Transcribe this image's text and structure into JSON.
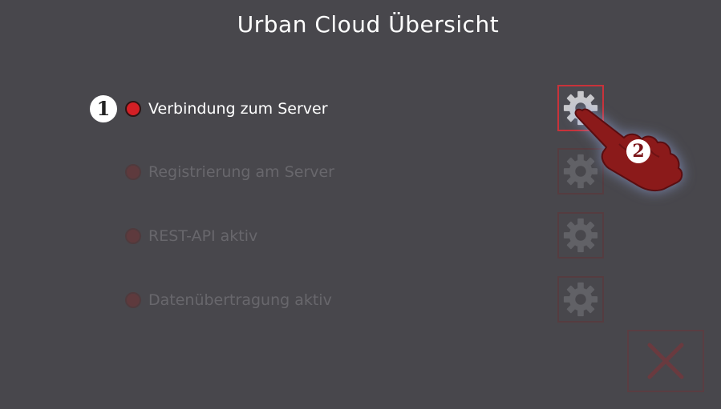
{
  "header": {
    "title": "Urban Cloud Übersicht"
  },
  "status_items": [
    {
      "label": "Verbindung zum Server",
      "state": "active",
      "indicator_color": "#d41f25"
    },
    {
      "label": "Registrierung am Server",
      "state": "disabled",
      "indicator_color": "#5e3a3d"
    },
    {
      "label": "REST-API aktiv",
      "state": "disabled",
      "indicator_color": "#5e3a3d"
    },
    {
      "label": "Datenübertragung aktiv",
      "state": "disabled",
      "indicator_color": "#5e3a3d"
    }
  ],
  "settings_buttons": [
    {
      "icon": "gear-icon",
      "state": "active"
    },
    {
      "icon": "gear-icon",
      "state": "disabled"
    },
    {
      "icon": "gear-icon",
      "state": "disabled"
    },
    {
      "icon": "gear-icon",
      "state": "disabled"
    }
  ],
  "close_button": {
    "icon": "close-x-icon",
    "state": "disabled"
  },
  "annotations": {
    "step1": "1",
    "step2": "2"
  },
  "colors": {
    "background": "#48474c",
    "accent_red": "#d41f25",
    "hand": "#8b1a1a",
    "disabled_text": "#68676c"
  }
}
